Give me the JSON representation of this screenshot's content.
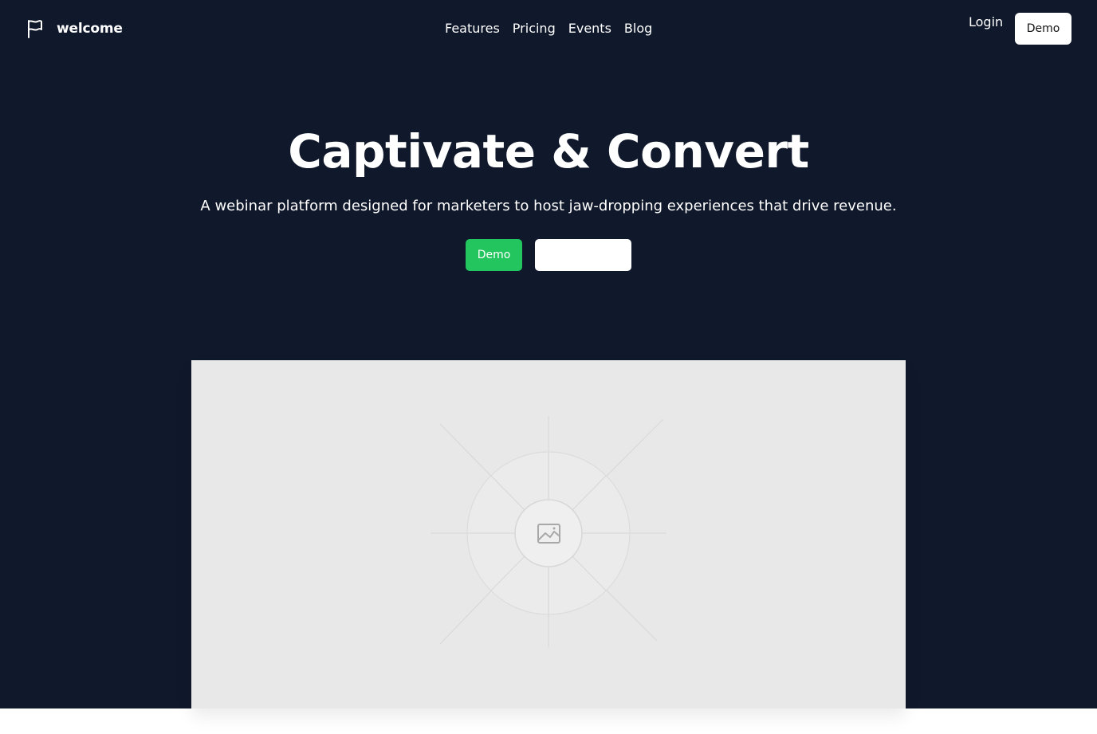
{
  "header": {
    "brand_name": "welcome",
    "nav": [
      "Features",
      "Pricing",
      "Events",
      "Blog"
    ],
    "login_label": "Login",
    "demo_label": "Demo"
  },
  "hero": {
    "headline": "Captivate & Convert",
    "subheadline": "A webinar platform designed for marketers to host jaw-dropping experiences that drive revenue.",
    "primary_cta_label": "Demo",
    "secondary_cta_label": ""
  },
  "media": {
    "placeholder_icon": "image-placeholder-icon"
  },
  "colors": {
    "background": "#10182b",
    "accent": "#22c55e",
    "placeholder": "#e8e8e8"
  }
}
